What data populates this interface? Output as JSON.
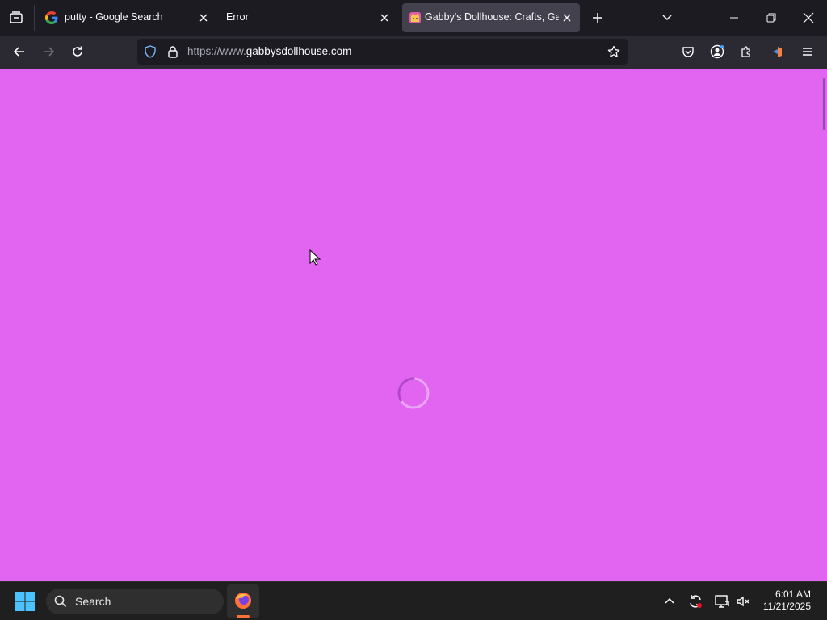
{
  "browser": {
    "tabs": [
      {
        "title": "putty - Google Search",
        "active": false,
        "favicon": "google-icon"
      },
      {
        "title": "Error",
        "active": false,
        "favicon": ""
      },
      {
        "title": "Gabby's Dollhouse: Crafts, Games",
        "active": true,
        "favicon": "gabbys-dollhouse-icon"
      }
    ],
    "url_prefix": "https://www.",
    "url_domain": "gabbysdollhouse.com"
  },
  "page": {
    "background_color": "#e165f0",
    "loading": true
  },
  "taskbar": {
    "search_label": "Search",
    "time": "6:01 AM",
    "date": "11/21/2025"
  }
}
